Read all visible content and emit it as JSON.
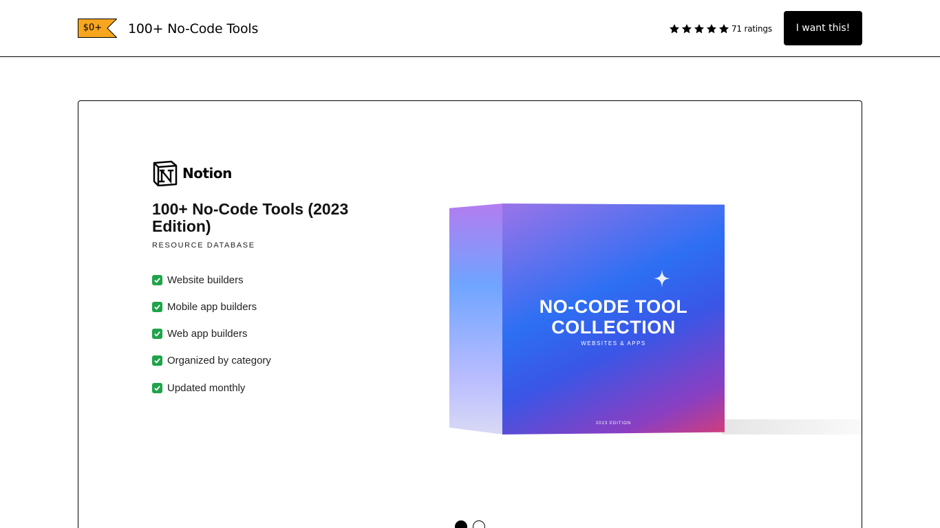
{
  "header": {
    "price": "$0+",
    "product_title": "100+ No-Code Tools",
    "rating": {
      "stars": 5,
      "count_text": "71 ratings"
    },
    "cta_label": "I want this!"
  },
  "colors": {
    "price_tag": "#f7a61e",
    "cta_background": "#000000",
    "check_green": "#1fa34a"
  },
  "carousel": {
    "active_index": 0,
    "slide_count": 2,
    "slide": {
      "brand": "Notion",
      "title": "100+ No-Code Tools (2023 Edition)",
      "subtitle": "RESOURCE DATABASE",
      "features": [
        "Website builders",
        "Mobile app builders",
        "Web app builders",
        "Organized by category",
        "Updated monthly"
      ],
      "box": {
        "title": "NO-CODE TOOL COLLECTION",
        "subtitle": "WEBSITES & APPS",
        "edition": "2023 EDITION"
      }
    }
  },
  "icons": {
    "price_tag": "price-tag-icon",
    "star": "star-icon",
    "notion": "notion-logo-icon",
    "check": "check-box-icon",
    "sparkle": "sparkle-icon"
  }
}
